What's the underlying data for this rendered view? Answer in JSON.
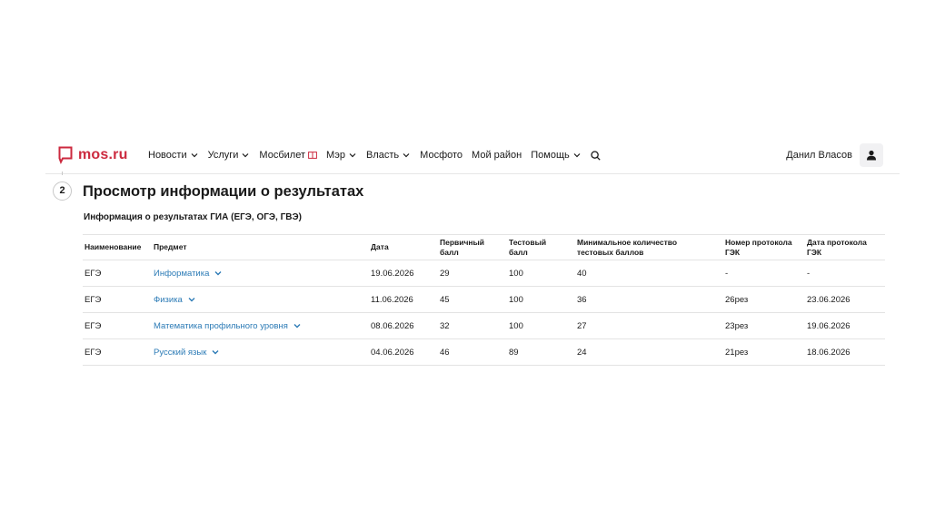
{
  "header": {
    "logo_text": "mos.ru",
    "nav": [
      {
        "label": "Новости",
        "has_chevron": true
      },
      {
        "label": "Услуги",
        "has_chevron": true
      },
      {
        "label": "Мосбилет",
        "has_chevron": false,
        "icon": "ticket-icon"
      },
      {
        "label": "Мэр",
        "has_chevron": true
      },
      {
        "label": "Власть",
        "has_chevron": true
      },
      {
        "label": "Мосфото",
        "has_chevron": false
      },
      {
        "label": "Мой район",
        "has_chevron": false
      },
      {
        "label": "Помощь",
        "has_chevron": true
      }
    ],
    "user_name": "Данил Власов",
    "brand_color": "#cc2a3f"
  },
  "step": {
    "number": "2",
    "title": "Просмотр информации о результатах",
    "subtitle": "Информация о результатах ГИА (ЕГЭ, ОГЭ, ГВЭ)"
  },
  "table": {
    "headers": [
      [
        "Наименование",
        ""
      ],
      [
        "Предмет",
        ""
      ],
      [
        "Дата",
        ""
      ],
      [
        "Первичный",
        "балл"
      ],
      [
        "Тестовый",
        "балл"
      ],
      [
        "Минимальное количество",
        "тестовых баллов"
      ],
      [
        "Номер протокола",
        "ГЭК"
      ],
      [
        "Дата протокола",
        "ГЭК"
      ]
    ],
    "rows": [
      {
        "exam": "ЕГЭ",
        "subject": "Информатика",
        "date": "19.06.2026",
        "primary": "29",
        "test": "100",
        "min": "40",
        "protocol_no": "-",
        "protocol_date": "-"
      },
      {
        "exam": "ЕГЭ",
        "subject": "Физика",
        "date": "11.06.2026",
        "primary": "45",
        "test": "100",
        "min": "36",
        "protocol_no": "26рез",
        "protocol_date": "23.06.2026"
      },
      {
        "exam": "ЕГЭ",
        "subject": "Математика профильного уровня",
        "date": "08.06.2026",
        "primary": "32",
        "test": "100",
        "min": "27",
        "protocol_no": "23рез",
        "protocol_date": "19.06.2026"
      },
      {
        "exam": "ЕГЭ",
        "subject": "Русский язык",
        "date": "04.06.2026",
        "primary": "46",
        "test": "89",
        "min": "24",
        "protocol_no": "21рез",
        "protocol_date": "18.06.2026"
      }
    ],
    "link_color": "#2c7bb6"
  }
}
